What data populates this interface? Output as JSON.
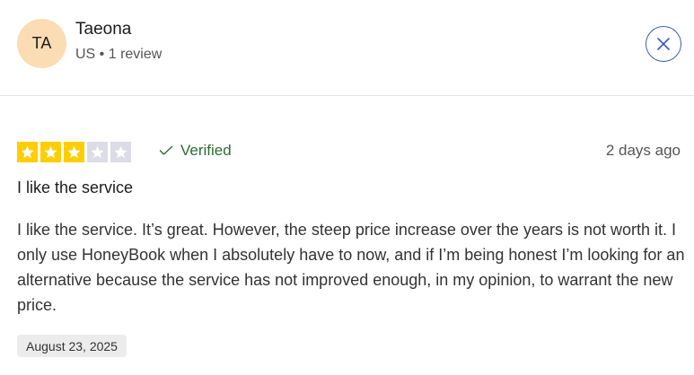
{
  "reviewer": {
    "initials": "TA",
    "name": "Taeona",
    "meta": "US • 1 review",
    "avatar_bg": "#fcdcb3"
  },
  "close": {
    "icon": "close-icon",
    "color": "#3a5fb0"
  },
  "review": {
    "rating": 3,
    "rating_max": 5,
    "star_color": "#ffce00",
    "star_empty_color": "#dcdce6",
    "verified_label": "Verified",
    "verified_color": "#2e6b35",
    "posted_ago": "2 days ago",
    "title": "I like the service",
    "body": "I like the service. It’s great. However, the steep price increase over the years is not worth it. I only use HoneyBook when I absolutely have to now, and if I’m being honest I’m looking for an alternative because the service has not improved enough, in my opinion, to warrant the new price.",
    "experience_date": "August 23, 2025"
  }
}
